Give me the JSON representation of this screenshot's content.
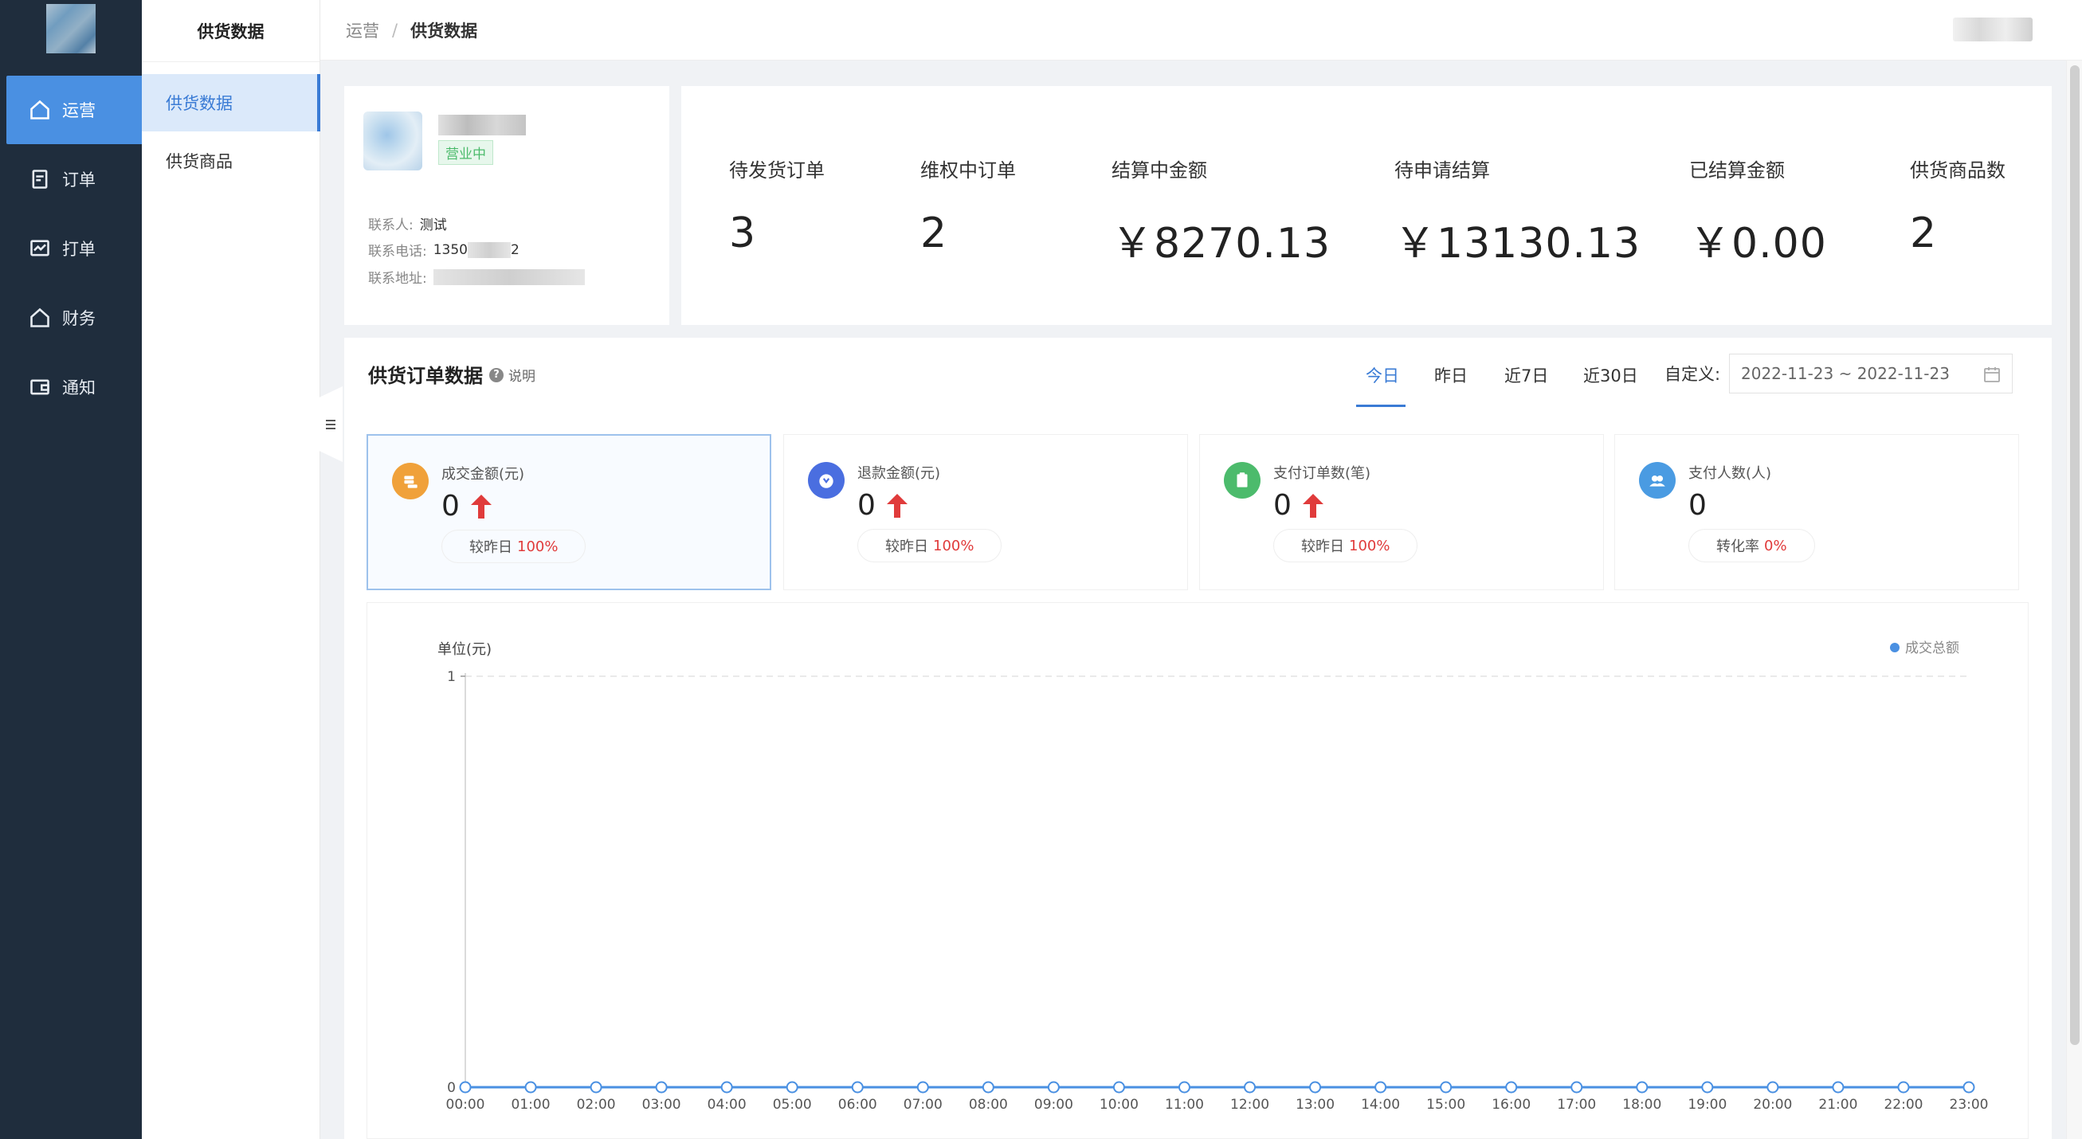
{
  "nav": {
    "items": [
      {
        "label": "运营",
        "icon": "home-icon",
        "active": true
      },
      {
        "label": "订单",
        "icon": "order-icon",
        "active": false
      },
      {
        "label": "打单",
        "icon": "print-icon",
        "active": false
      },
      {
        "label": "财务",
        "icon": "finance-icon",
        "active": false
      },
      {
        "label": "通知",
        "icon": "notice-icon",
        "active": false
      }
    ]
  },
  "subnav": {
    "title": "供货数据",
    "items": [
      {
        "label": "供货数据",
        "active": true
      },
      {
        "label": "供货商品",
        "active": false
      }
    ]
  },
  "breadcrumb": {
    "parent": "运营",
    "separator": "/",
    "current": "供货数据"
  },
  "store": {
    "status": "营业中",
    "contact_label": "联系人:",
    "contact_value": "测试",
    "phone_label": "联系电话:",
    "phone_prefix": "1350",
    "phone_suffix": "2",
    "address_label": "联系地址:"
  },
  "stats": [
    {
      "label": "待发货订单",
      "value": "3"
    },
    {
      "label": "维权中订单",
      "value": "2"
    },
    {
      "label": "结算中金额",
      "value": "￥8270.13"
    },
    {
      "label": "待申请结算",
      "value": "￥13130.13"
    },
    {
      "label": "已结算金额",
      "value": "￥0.00"
    },
    {
      "label": "供货商品数",
      "value": "2"
    }
  ],
  "orders": {
    "title": "供货订单数据",
    "help": "说明",
    "tabs": [
      {
        "label": "今日",
        "active": true
      },
      {
        "label": "昨日",
        "active": false
      },
      {
        "label": "近7日",
        "active": false
      },
      {
        "label": "近30日",
        "active": false
      }
    ],
    "custom_label": "自定义:",
    "date_range": "2022-11-23 ~ 2022-11-23"
  },
  "metrics": [
    {
      "label": "成交金额(元)",
      "value": "0",
      "compare_label": "较昨日",
      "compare_value": "100%",
      "icon": "coins-icon",
      "color": "#f0a13a",
      "trend_up": true,
      "active": true
    },
    {
      "label": "退款金额(元)",
      "value": "0",
      "compare_label": "较昨日",
      "compare_value": "100%",
      "icon": "refund-icon",
      "color": "#4a6ee0",
      "trend_up": true,
      "active": false
    },
    {
      "label": "支付订单数(笔)",
      "value": "0",
      "compare_label": "较昨日",
      "compare_value": "100%",
      "icon": "clipboard-icon",
      "color": "#4cbb6c",
      "trend_up": true,
      "active": false
    },
    {
      "label": "支付人数(人)",
      "value": "0",
      "compare_label": "转化率",
      "compare_value": "0%",
      "icon": "users-icon",
      "color": "#4a9be2",
      "trend_up": false,
      "active": false
    }
  ],
  "chart_data": {
    "type": "line",
    "ylabel": "单位(元)",
    "ylim": [
      0,
      1
    ],
    "yticks": [
      "0",
      "1"
    ],
    "categories": [
      "00:00",
      "01:00",
      "02:00",
      "03:00",
      "04:00",
      "05:00",
      "06:00",
      "07:00",
      "08:00",
      "09:00",
      "10:00",
      "11:00",
      "12:00",
      "13:00",
      "14:00",
      "15:00",
      "16:00",
      "17:00",
      "18:00",
      "19:00",
      "20:00",
      "21:00",
      "22:00",
      "23:00"
    ],
    "series": [
      {
        "name": "成交总额",
        "values": [
          0,
          0,
          0,
          0,
          0,
          0,
          0,
          0,
          0,
          0,
          0,
          0,
          0,
          0,
          0,
          0,
          0,
          0,
          0,
          0,
          0,
          0,
          0,
          0
        ]
      }
    ],
    "legend_position": "top-right",
    "grid": true,
    "color": "#4a90e2"
  }
}
